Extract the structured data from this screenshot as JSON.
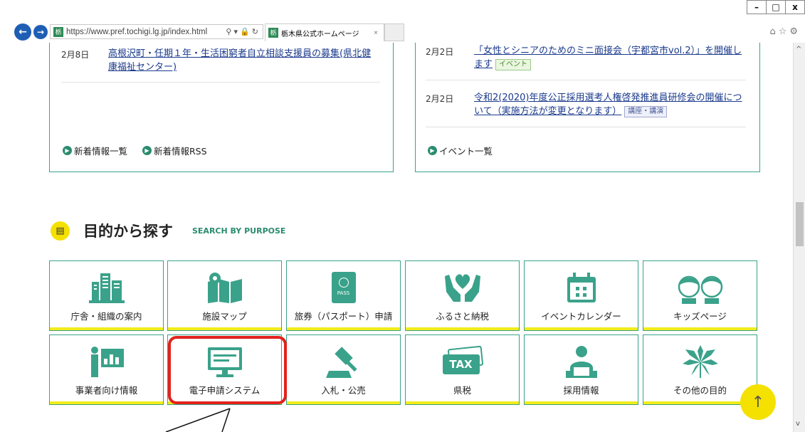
{
  "browser": {
    "url": "https://www.pref.tochigi.lg.jp/index.html",
    "tab_title": "栃木県公式ホームページ",
    "window_buttons": [
      "–",
      "□",
      "x"
    ]
  },
  "news_left": {
    "items": [
      {
        "date": "2月8日",
        "text": "高根沢町・任期１年・生活困窮者自立相談支援員の募集(県北健康福祉センター)"
      }
    ],
    "links": [
      "新着情報一覧",
      "新着情報RSS"
    ]
  },
  "news_right": {
    "items": [
      {
        "date": "2月2日",
        "text": "「女性とシニアのためのミニ面接会（宇都宮市vol.2）」を開催します",
        "badge": "イベント"
      },
      {
        "date": "2月2日",
        "text": "令和2(2020)年度公正採用選考人権啓発推進員研修会の開催について（実施方法が変更となります）",
        "badge": "講座・講演"
      }
    ],
    "links": [
      "イベント一覧"
    ]
  },
  "purpose": {
    "title": "目的から探す",
    "subtitle": "SEARCH BY PURPOSE",
    "tiles": [
      {
        "label": "庁舎・組織の案内",
        "icon": "building-icon"
      },
      {
        "label": "施設マップ",
        "icon": "map-icon"
      },
      {
        "label": "旅券（パスポート）申請",
        "icon": "passport-icon",
        "icon_text": "PASS"
      },
      {
        "label": "ふるさと納税",
        "icon": "heart-hands-icon"
      },
      {
        "label": "イベントカレンダー",
        "icon": "calendar-icon"
      },
      {
        "label": "キッズページ",
        "icon": "kids-icon"
      },
      {
        "label": "事業者向け情報",
        "icon": "presentation-icon"
      },
      {
        "label": "電子申請システム",
        "icon": "computer-icon"
      },
      {
        "label": "入札・公売",
        "icon": "gavel-icon"
      },
      {
        "label": "県税",
        "icon": "tax-icon",
        "icon_text": "TAX"
      },
      {
        "label": "採用情報",
        "icon": "worker-icon"
      },
      {
        "label": "その他の目的",
        "icon": "leaf-icon"
      }
    ]
  },
  "colors": {
    "accent": "#3aa28a",
    "yellow": "#f2ec1a",
    "highlight": "#e2221c",
    "link": "#1a3a8c"
  }
}
